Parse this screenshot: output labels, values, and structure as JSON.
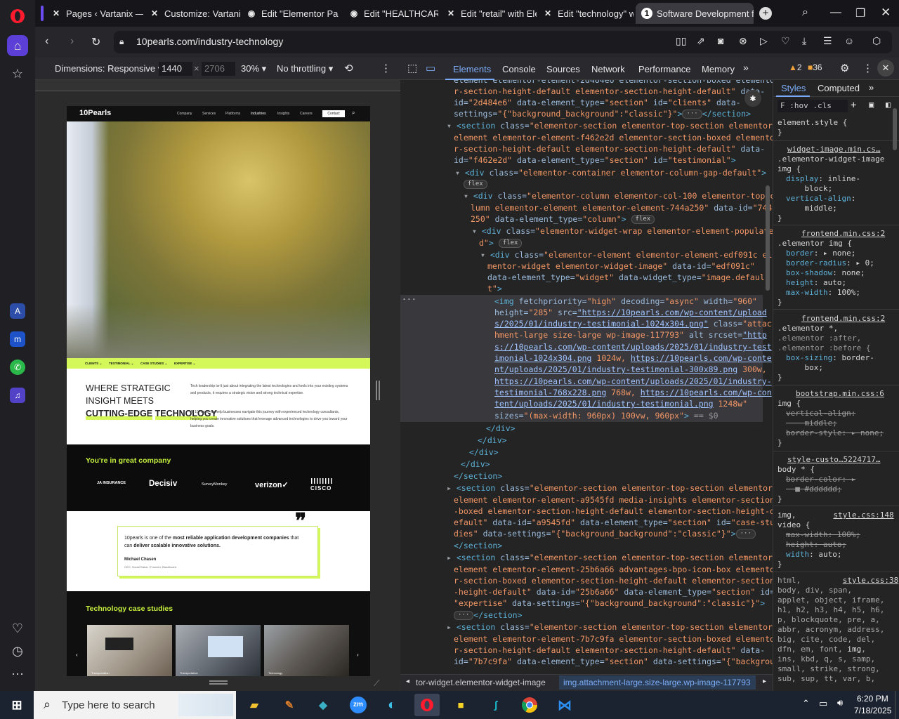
{
  "browser": {
    "tabs": [
      {
        "title": "Pages ‹ Vartanix — W",
        "icon": "wordpress-icon"
      },
      {
        "title": "Customize: Vartanix |",
        "icon": "wordpress-icon"
      },
      {
        "title": "Edit \"Elementor Page",
        "icon": "wordpress-icon"
      },
      {
        "title": "Edit \"HEALTHCARE\"",
        "icon": "elementor-icon"
      },
      {
        "title": "Edit \"retail\" with Elem",
        "icon": "elementor-icon"
      },
      {
        "title": "Edit \"technology\" wi",
        "icon": "elementor-icon"
      },
      {
        "title": "Software Development for",
        "icon": "10pearls-icon"
      }
    ],
    "url": "10pearls.com/industry-technology"
  },
  "device_toolbar": {
    "dimensions_label": "Dimensions: Responsive ▾",
    "width": "1440",
    "height_placeholder": "2706",
    "zoom": "30% ▾",
    "throttle": "No throttling ▾"
  },
  "site": {
    "logo": "10Pearls",
    "nav": [
      "Company",
      "Services",
      "Platforms",
      "Industries",
      "Insights",
      "Careers"
    ],
    "contact": "Contact",
    "subnav": [
      "CLIENTS ⌄",
      "TESTIMONIAL ⌄",
      "CASE STUDIES ⌄",
      "EXPERTISE ⌄"
    ],
    "headline_1": "WHERE STRATEGIC",
    "headline_2": "INSIGHT MEETS",
    "headline_3": "CUTTING-EDGE",
    "headline_4": "TECHNOLOGY",
    "para_1": "Tech leadership isn't just about integrating the latest technologies and tools into your existing systems and products, it requires a strategic vision and strong technical expertise.",
    "para_2": "At 10Pearls, we help businesses navigate this journey with experienced technology consultants, helping you create innovative solutions that leverage advanced technologies to drive you toward your business goals.",
    "company_title": "You're in great company",
    "logos": [
      "JA INSURANCE",
      "Decisiv",
      "SurveyMonkey",
      "verizon✓",
      "CISCO"
    ],
    "quote_pre": "10pearls is one of the ",
    "quote_b1": "most reliable application development companies",
    "quote_mid": " that can ",
    "quote_b2": "deliver scalable innovative solutions.",
    "quote_author": "Michael Chasen",
    "quote_role": "CEO, Social Rabar / Founder, Blackboard",
    "case_title": "Technology case studies",
    "case_caps": [
      "Transportation",
      "Transportation",
      "Technology"
    ]
  },
  "devtools": {
    "tabs": [
      "Elements",
      "Console",
      "Sources",
      "Network",
      "Performance",
      "Memory"
    ],
    "warnings": "2",
    "issues": "36",
    "styles_tabs": [
      "Styles",
      "Computed"
    ],
    "filter": "F :hov .cls",
    "breadcrumb_1": "tor-widget.elementor-widget-image",
    "breadcrumb_2": "img.attachment-large.size-large.wp-image-117793"
  },
  "taskbar": {
    "search_placeholder": "Type here to search",
    "time": "6:20 PM",
    "date": "7/18/2025"
  }
}
